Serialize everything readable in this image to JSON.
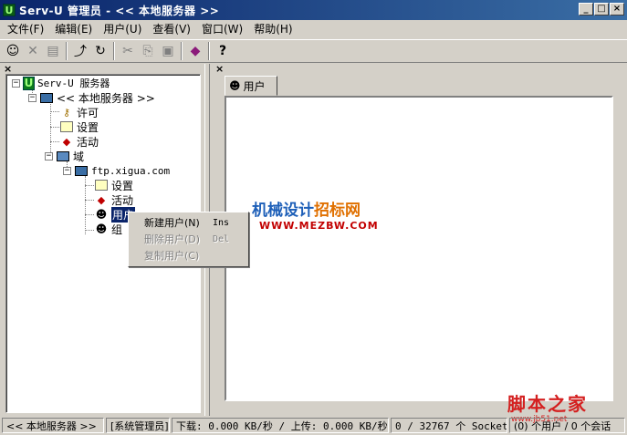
{
  "window": {
    "title": "Serv-U 管理员 - << 本地服务器 >>",
    "app_icon": "U",
    "controls": [
      "_",
      "□",
      "×"
    ]
  },
  "menu": [
    "文件(F)",
    "编辑(E)",
    "用户(U)",
    "查看(V)",
    "窗口(W)",
    "帮助(H)"
  ],
  "toolbar": {
    "buttons": [
      {
        "name": "connect-icon",
        "glyph": "☺",
        "enabled": true
      },
      {
        "name": "delete-icon",
        "glyph": "✕",
        "enabled": false
      },
      {
        "name": "properties-icon",
        "glyph": "▤",
        "enabled": false
      },
      {
        "name": "up-folder-icon",
        "glyph": "⤴",
        "enabled": true
      },
      {
        "name": "refresh-icon",
        "glyph": "↻",
        "enabled": true
      },
      {
        "name": "cut-icon",
        "glyph": "✂",
        "enabled": false
      },
      {
        "name": "copy-icon",
        "glyph": "⎘",
        "enabled": false
      },
      {
        "name": "paste-icon",
        "glyph": "▣",
        "enabled": false
      },
      {
        "name": "book-icon",
        "glyph": "◆",
        "enabled": true
      },
      {
        "name": "help-icon",
        "glyph": "?",
        "enabled": true
      }
    ]
  },
  "tree": {
    "root": "Serv-U 服务器",
    "server": "<< 本地服务器 >>",
    "license": "许可",
    "settings": "设置",
    "activity": "活动",
    "domains": "域",
    "domain_name": "ftp.xigua.com",
    "domain_settings": "设置",
    "domain_activity": "活动",
    "users": "用户",
    "groups": "组"
  },
  "tab": {
    "label": "用户"
  },
  "context_menu": {
    "items": [
      {
        "label": "新建用户(N)",
        "shortcut": "Ins",
        "enabled": true
      },
      {
        "label": "删除用户(D)",
        "shortcut": "Del",
        "enabled": false
      },
      {
        "label": "复制用户(C)",
        "shortcut": "",
        "enabled": false
      }
    ]
  },
  "watermark": {
    "line1_a": "机械设计",
    "line1_b": "招标网",
    "line2": "WWW.MEZBW.COM",
    "brand": "脚本之家",
    "brand_url": "www.jb51.net"
  },
  "status": {
    "server": "<< 本地服务器 >>",
    "role": "[系统管理员]",
    "transfer": "下载: 0.000 KB/秒 / 上传: 0.000 KB/秒",
    "sockets": "0 / 32767 个 Socket",
    "users": "(0) 个用户 / 0 个会话"
  },
  "colors": {
    "titlebar_start": "#0a246a",
    "titlebar_end": "#3a6ea5",
    "face": "#d4d0c8",
    "selection": "#0a246a"
  }
}
